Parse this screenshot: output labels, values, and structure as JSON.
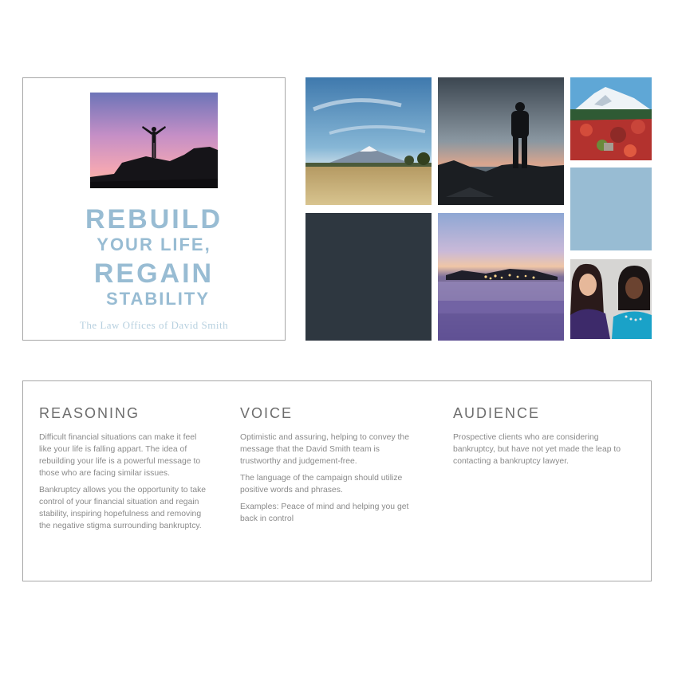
{
  "brand": {
    "headline_line1": "REBUILD",
    "headline_line2": "YOUR LIFE,",
    "headline_line3": "REGAIN",
    "headline_line4": "STABILITY",
    "firm_name": "The Law Offices of David Smith",
    "accent_color": "#98bcd3",
    "dark_color": "#2e3740"
  },
  "moodboard": {
    "tiles": [
      {
        "name": "mountain-meadow-photo",
        "kind": "photo"
      },
      {
        "name": "hiker-sunset-photo",
        "kind": "photo"
      },
      {
        "name": "snowy-peak-wildflowers-photo",
        "kind": "photo"
      },
      {
        "name": "dark-color-swatch",
        "kind": "swatch",
        "color": "#2e3740"
      },
      {
        "name": "foggy-city-lights-photo",
        "kind": "photo"
      },
      {
        "name": "light-blue-color-swatch",
        "kind": "swatch",
        "color": "#98bcd3"
      },
      {
        "name": "two-women-smiling-photo",
        "kind": "photo"
      }
    ]
  },
  "sections": {
    "reasoning": {
      "title": "REASONING",
      "p1": "Difficult financial situations can make it feel like your life is falling appart. The idea of rebuilding your life is a powerful message to those who are facing similar issues.",
      "p2": "Bankruptcy allows you the opportunity to take control of your financial situation and regain stability, inspiring hopefulness and removing the negative stigma surrounding bankruptcy."
    },
    "voice": {
      "title": "VOICE",
      "p1": "Optimistic and assuring, helping to convey the message that the David Smith team is trustworthy and judgement-free.",
      "p2": "The language of the campaign should utilize positive words and phrases.",
      "p3": "Examples: Peace of mind and helping you get back in control"
    },
    "audience": {
      "title": "AUDIENCE",
      "p1": "Prospective clients who are considering bankruptcy, but have not yet made the leap to contacting a bankruptcy lawyer."
    }
  }
}
